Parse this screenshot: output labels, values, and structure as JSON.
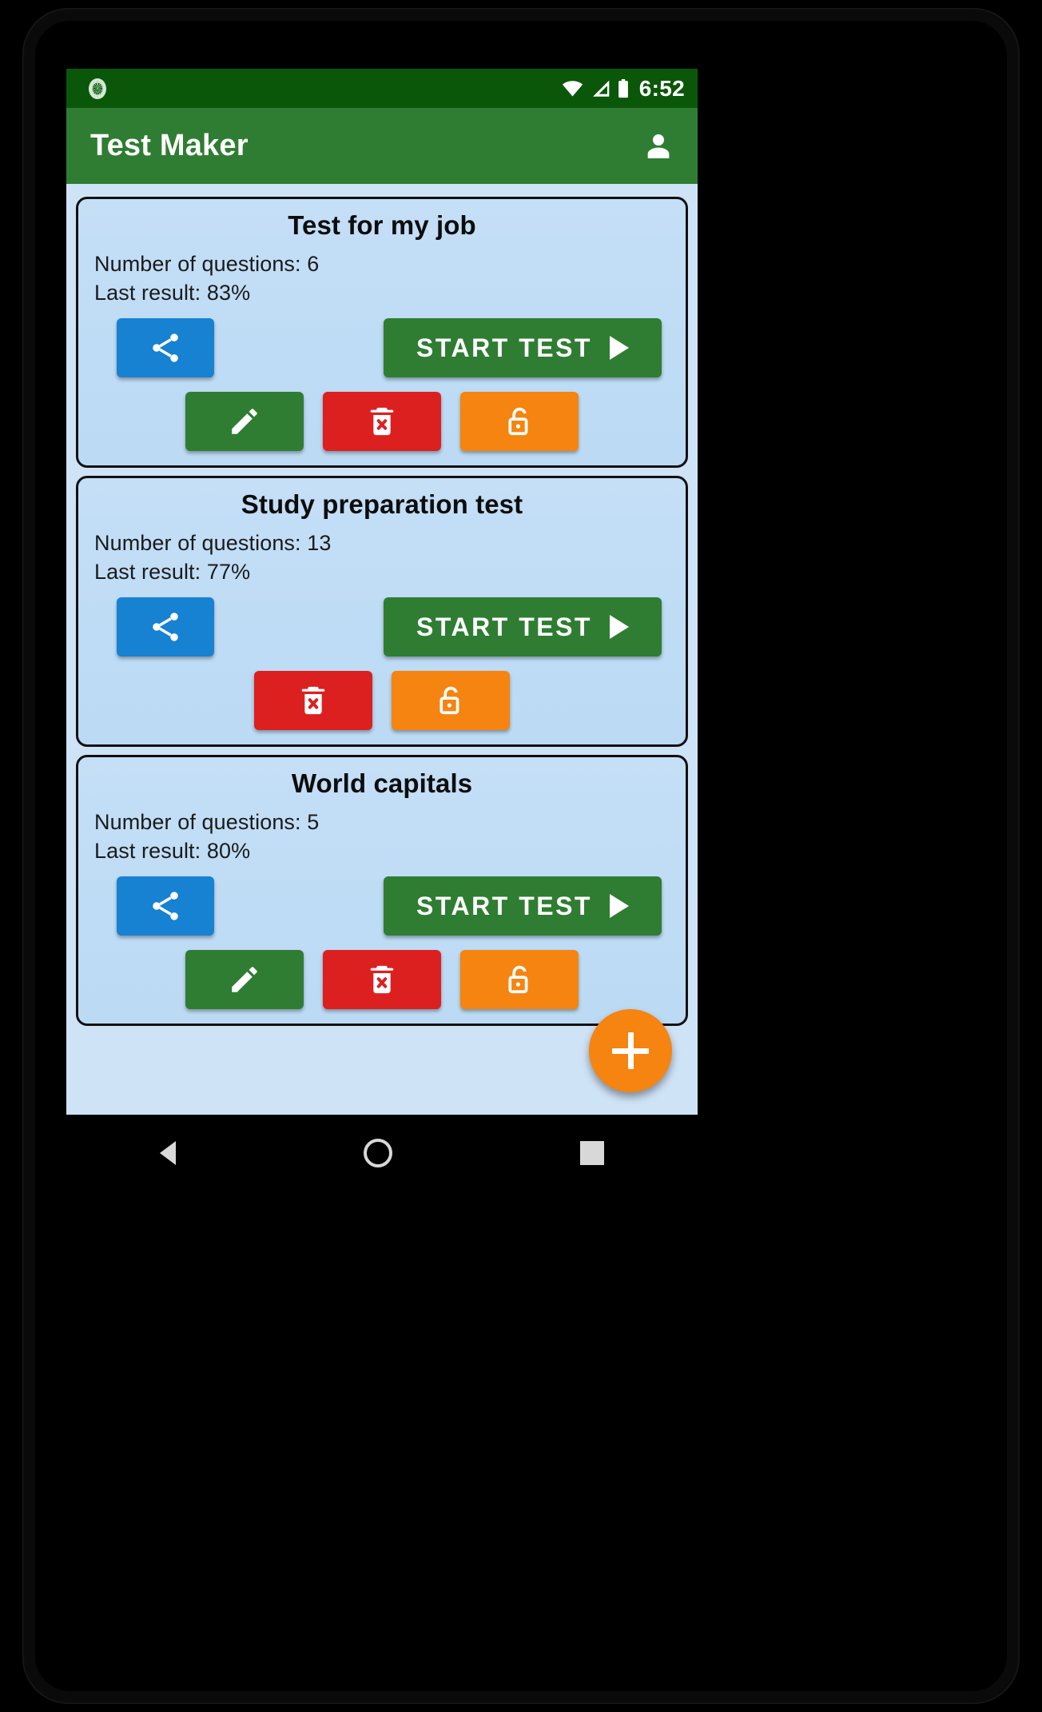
{
  "status_bar": {
    "time": "6:52",
    "icons": [
      "app-notification-icon",
      "wifi-icon",
      "cell-signal-icon",
      "battery-icon"
    ],
    "background": "#0b5709"
  },
  "app_bar": {
    "title": "Test Maker",
    "account_icon": "person-icon",
    "background": "#2f7d32"
  },
  "labels": {
    "questions_prefix": "Number of questions:",
    "result_prefix": "Last result:",
    "start_test": "START TEST"
  },
  "colors": {
    "green": "#2f7d32",
    "blue": "#1781d2",
    "red": "#dc2020",
    "orange": "#f58410",
    "card_bg": "#c4dff6",
    "screen_bg": "#cfe3f7"
  },
  "cards": [
    {
      "title": "Test for my job",
      "questions_label": "Number of questions: 6",
      "result_label": "Last result:  83%",
      "questions": 6,
      "last_result": "83%",
      "start_label": "START TEST",
      "share_icon": "share-icon",
      "actions": [
        "edit-icon",
        "delete-icon",
        "unlock-icon"
      ]
    },
    {
      "title": "Study preparation test",
      "questions_label": "Number of questions: 13",
      "result_label": "Last result:  77%",
      "questions": 13,
      "last_result": "77%",
      "start_label": "START TEST",
      "share_icon": "share-icon",
      "actions": [
        "delete-icon",
        "unlock-icon"
      ]
    },
    {
      "title": "World capitals",
      "questions_label": "Number of questions: 5",
      "result_label": "Last result:  80%",
      "questions": 5,
      "last_result": "80%",
      "start_label": "START TEST",
      "share_icon": "share-icon",
      "actions": [
        "edit-icon",
        "delete-icon",
        "unlock-icon"
      ]
    }
  ],
  "fab": {
    "icon": "plus-icon",
    "label": "+"
  },
  "nav_bar": {
    "back": "back-triangle-icon",
    "home": "home-circle-icon",
    "recents": "recents-square-icon"
  }
}
